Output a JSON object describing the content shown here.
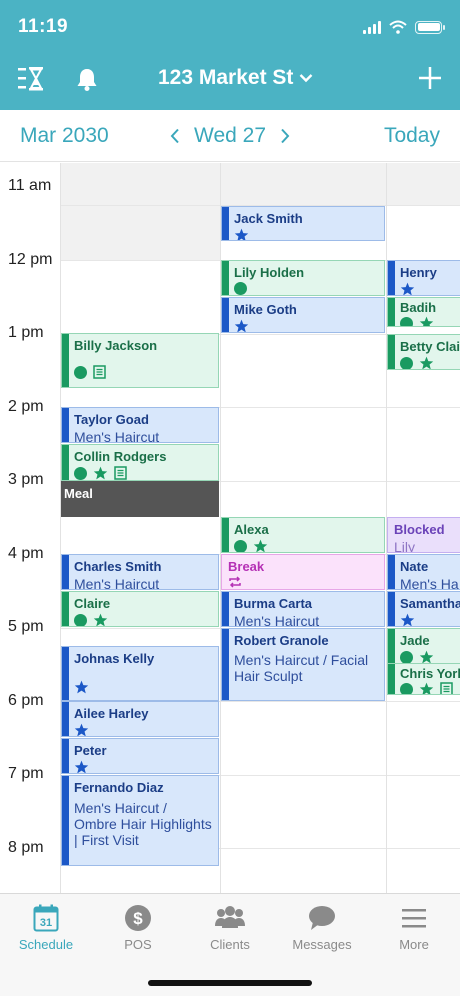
{
  "status": {
    "time": "11:19"
  },
  "header": {
    "location": "123 Market St"
  },
  "datebar": {
    "month": "Mar 2030",
    "day": "Wed 27",
    "today": "Today"
  },
  "time_labels": [
    "11 am",
    "12 pm",
    "1 pm",
    "2 pm",
    "3 pm",
    "4 pm",
    "5 pm",
    "6 pm",
    "7 pm",
    "8 pm"
  ],
  "appointments": {
    "jack_smith": {
      "name": "Jack Smith"
    },
    "lily_holden": {
      "name": "Lily Holden"
    },
    "mike_goth": {
      "name": "Mike Goth"
    },
    "henry": {
      "name": "Henry"
    },
    "badih": {
      "name": "Badih"
    },
    "betty_clair": {
      "name": "Betty Clair"
    },
    "billy_jackson": {
      "name": "Billy Jackson"
    },
    "taylor_goad": {
      "name": "Taylor Goad",
      "service": "Men's Haircut"
    },
    "collin_rodgers": {
      "name": "Collin Rodgers"
    },
    "meal": {
      "name": "Meal"
    },
    "alexa": {
      "name": "Alexa"
    },
    "blocked": {
      "name": "Blocked",
      "note": "Lily"
    },
    "break": {
      "name": "Break"
    },
    "charles_smith": {
      "name": "Charles Smith",
      "service": "Men's Haircut"
    },
    "nate": {
      "name": "Nate",
      "service": "Men's Ha"
    },
    "burma_carta": {
      "name": "Burma Carta",
      "service": "Men's Haircut"
    },
    "claire": {
      "name": "Claire"
    },
    "samantha": {
      "name": "Samantha"
    },
    "robert_granole": {
      "name": "Robert Granole",
      "service": "Men's Haircut / Facial Hair Sculpt"
    },
    "jade": {
      "name": "Jade"
    },
    "chris_york": {
      "name": "Chris York"
    },
    "johnas_kelly": {
      "name": "Johnas Kelly"
    },
    "ailee_harley": {
      "name": "Ailee Harley"
    },
    "peter": {
      "name": "Peter"
    },
    "fernando_diaz": {
      "name": "Fernando Diaz",
      "service": "Men's Haircut / Ombre Hair Highlights | First Visit"
    }
  },
  "tabs": {
    "schedule": {
      "label": "Schedule",
      "icon_text": "31"
    },
    "pos": {
      "label": "POS",
      "icon_text": "$"
    },
    "clients": {
      "label": "Clients"
    },
    "messages": {
      "label": "Messages"
    },
    "more": {
      "label": "More"
    }
  },
  "colors": {
    "brand": "#4bb3c4",
    "accent": "#3aa7bb",
    "appt_blue": "#1c58c7",
    "appt_green": "#1a9a61",
    "break_pink": "#b531b5",
    "blocked_purple": "#6b43b8"
  }
}
